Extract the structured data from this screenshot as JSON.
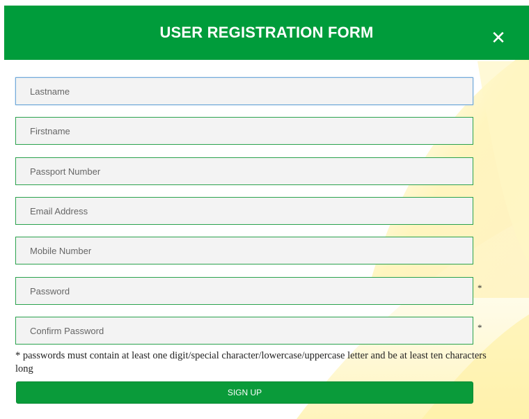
{
  "header": {
    "title": "USER REGISTRATION FORM",
    "close_glyph": "✕"
  },
  "fields": [
    {
      "name": "lastname-field",
      "placeholder": "Lastname",
      "value": "",
      "focused": true,
      "required": false
    },
    {
      "name": "firstname-field",
      "placeholder": "Firstname",
      "value": "",
      "focused": false,
      "required": false
    },
    {
      "name": "passport-number-field",
      "placeholder": "Passport Number",
      "value": "",
      "focused": false,
      "required": false
    },
    {
      "name": "email-address-field",
      "placeholder": "Email Address",
      "value": "",
      "focused": false,
      "required": false
    },
    {
      "name": "mobile-number-field",
      "placeholder": "Mobile Number",
      "value": "",
      "focused": false,
      "required": false
    },
    {
      "name": "password-field",
      "placeholder": "Password",
      "value": "",
      "focused": false,
      "required": true
    },
    {
      "name": "confirm-password-field",
      "placeholder": "Confirm Password",
      "value": "",
      "focused": false,
      "required": true
    }
  ],
  "required_marker": "*",
  "password_note": "* passwords must contain at least one digit/special character/lowercase/uppercase letter and be at least ten characters long",
  "signup_label": "SIGN UP",
  "colors": {
    "header_green": "#009c3b",
    "field_border": "#2aa24d",
    "focus_border": "#6fa8d8",
    "field_bg": "#f3f3f3",
    "button_green": "#0a9b3a",
    "accent_yellow": "#fff3b0"
  }
}
